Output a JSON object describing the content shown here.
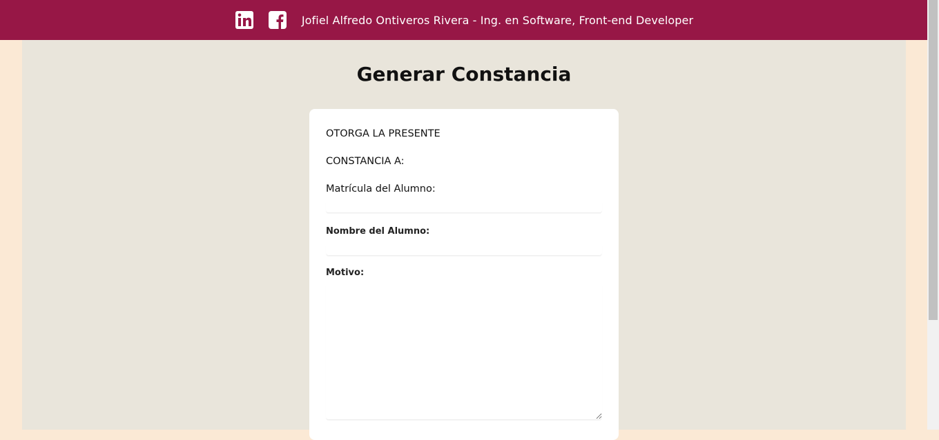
{
  "header": {
    "author_text": "Jofiel Alfredo Ontiveros Rivera - Ing. en Software, Front-end Developer",
    "icons": [
      "linkedin-icon",
      "facebook-icon"
    ],
    "background_color": "#971746"
  },
  "main": {
    "title": "Generar Constancia",
    "card": {
      "line1": "OTORGA LA PRESENTE",
      "line2": "CONSTANCIA A:",
      "matricula_label": "Matrícula del Alumno:",
      "matricula_value": "",
      "nombre_label": "Nombre del Alumno:",
      "nombre_value": "",
      "motivo_label": "Motivo:",
      "motivo_value": ""
    }
  },
  "colors": {
    "page_background": "#fbe9d5",
    "content_background": "#e9e5db",
    "card_background": "#ffffff"
  }
}
